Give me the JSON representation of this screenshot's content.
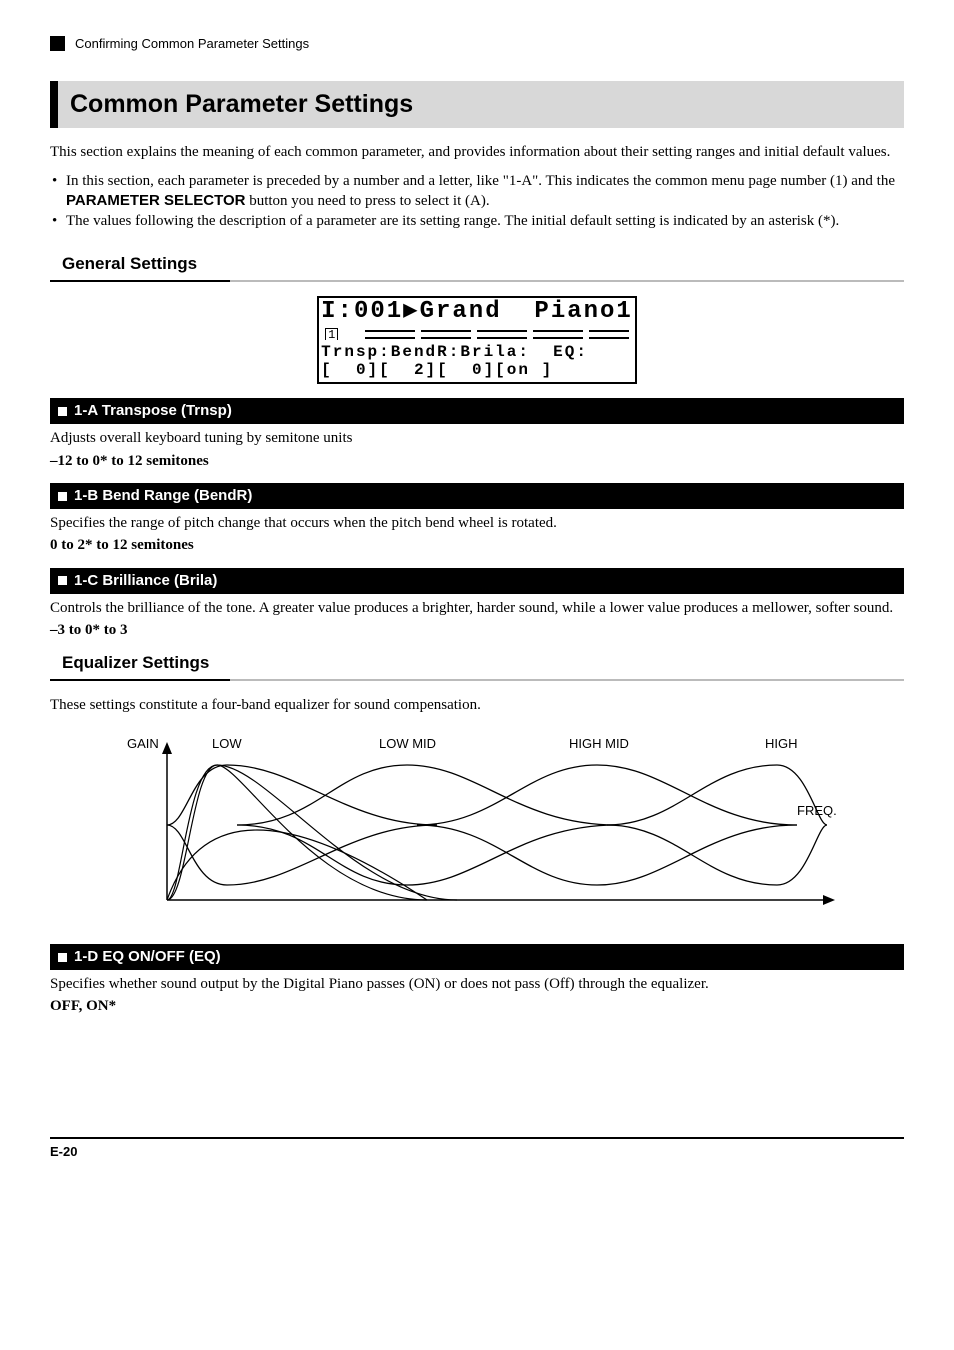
{
  "header": {
    "breadcrumb": "Confirming Common Parameter Settings"
  },
  "title": "Common Parameter Settings",
  "intro": "This section explains the meaning of each common parameter, and provides information about their setting ranges and initial default values.",
  "bullets": [
    {
      "pre": "In this section, each parameter is preceded by a number and a letter, like \"1-A\". This indicates the common menu page number (1) and the ",
      "bold": "PARAMETER SELECTOR",
      "post": " button you need to press to select it (A)."
    },
    {
      "pre": "The values following the description of a parameter are its setting range. The initial default setting is indicated by an asterisk (*).",
      "bold": "",
      "post": ""
    }
  ],
  "general_heading": "General Settings",
  "lcd": {
    "line1": "I:001▶Grand  Piano1",
    "page": "1",
    "line3": "Trnsp:BendR:Brila:  EQ:",
    "line4": "[  0][  2][  0][on ]"
  },
  "params": [
    {
      "title": "1-A Transpose (Trnsp)",
      "desc": "Adjusts overall keyboard tuning by semitone units",
      "range": "–12 to 0* to 12 semitones"
    },
    {
      "title": "1-B Bend Range (BendR)",
      "desc": "Specifies the range of pitch change that occurs when the pitch bend wheel is rotated.",
      "range": "0 to 2* to 12 semitones"
    },
    {
      "title": "1-C Brilliance (Brila)",
      "desc": "Controls the brilliance of the tone. A greater value produces a brighter, harder sound, while a lower value produces a mellower, softer sound.",
      "range": "–3 to 0* to 3"
    }
  ],
  "eq_heading": "Equalizer Settings",
  "eq_desc": "These settings constitute a four-band equalizer for sound compensation.",
  "eq_labels": {
    "gain": "GAIN",
    "low": "LOW",
    "lowmid": "LOW MID",
    "highmid": "HIGH MID",
    "high": "HIGH",
    "freq": "FREQ."
  },
  "param_d": {
    "title": "1-D EQ ON/OFF (EQ)",
    "desc": "Specifies whether sound output by the Digital Piano passes (ON) or does not pass (Off) through the equalizer.",
    "range": "OFF, ON*"
  },
  "footer": "E-20"
}
